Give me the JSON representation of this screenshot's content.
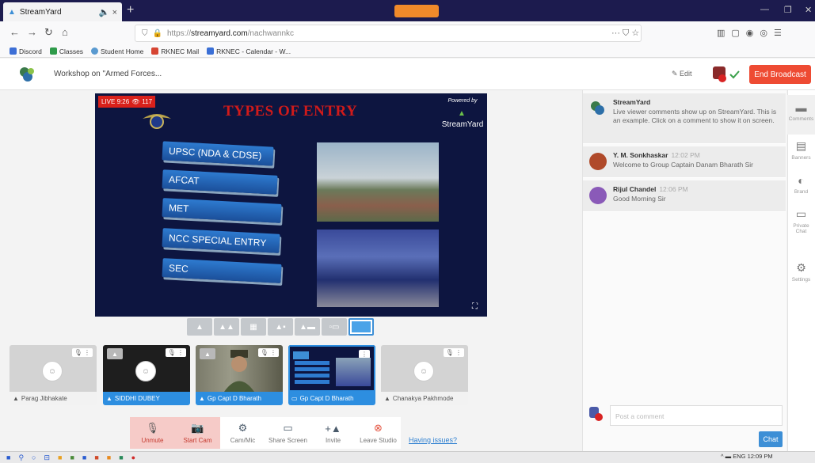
{
  "browser": {
    "tab_title": "StreamYard",
    "url_protocol": "https://",
    "url_host": "streamyard.com",
    "url_path": "/nachwannkc",
    "bookmarks": [
      "Discord",
      "Classes",
      "Student Home",
      "RKNEC Mail",
      "RKNEC - Calendar - W..."
    ]
  },
  "header": {
    "broadcast_title": "Workshop on \"Armed Forces...",
    "edit_label": "Edit",
    "end_button": "End Broadcast"
  },
  "stage": {
    "live_label": "LIVE 9:26",
    "viewers": "117",
    "slide_title": "TYPES OF ENTRY",
    "powered_by": "Powered by",
    "brand": "StreamYard",
    "entries": [
      "UPSC (NDA & CDSE)",
      "AFCAT",
      "MET",
      "NCC SPECIAL ENTRY",
      "SEC"
    ]
  },
  "participants": [
    {
      "name": "Parag Jibhakate",
      "on_stage": false
    },
    {
      "name": "SIDDHI DUBEY",
      "on_stage": true
    },
    {
      "name": "Gp Capt D Bharath",
      "on_stage": true
    },
    {
      "name": "Gp Capt D Bharath",
      "on_stage": true
    },
    {
      "name": "Chanakya Pakhmode",
      "on_stage": false
    }
  ],
  "toolbar": {
    "unmute": "Unmute",
    "start_cam": "Start Cam",
    "cam_mic": "Cam/Mic",
    "share_screen": "Share Screen",
    "invite": "Invite",
    "leave": "Leave Studio",
    "issues_link": "Having issues?"
  },
  "comments": [
    {
      "author": "StreamYard",
      "time": "",
      "text": "Live viewer comments show up on StreamYard. This is an example. Click on a comment to show it on screen."
    },
    {
      "author": "Y. M. Sonkhaskar",
      "time": "12:02 PM",
      "text": "Welcome to Group Captain Danam Bharath Sir"
    },
    {
      "author": "Rijul Chandel",
      "time": "12:06 PM",
      "text": "Good Morning Sir"
    }
  ],
  "comment_input_placeholder": "Post a comment",
  "chat_button": "Chat",
  "rail": [
    "Comments",
    "Banners",
    "Brand",
    "Private Chat",
    "Settings"
  ],
  "taskbar": {
    "lang": "ENG",
    "time": "12:09 PM"
  },
  "colors": {
    "accent": "#3d8fd6",
    "danger": "#ee4b33",
    "stage_bg": "#0d1540"
  }
}
